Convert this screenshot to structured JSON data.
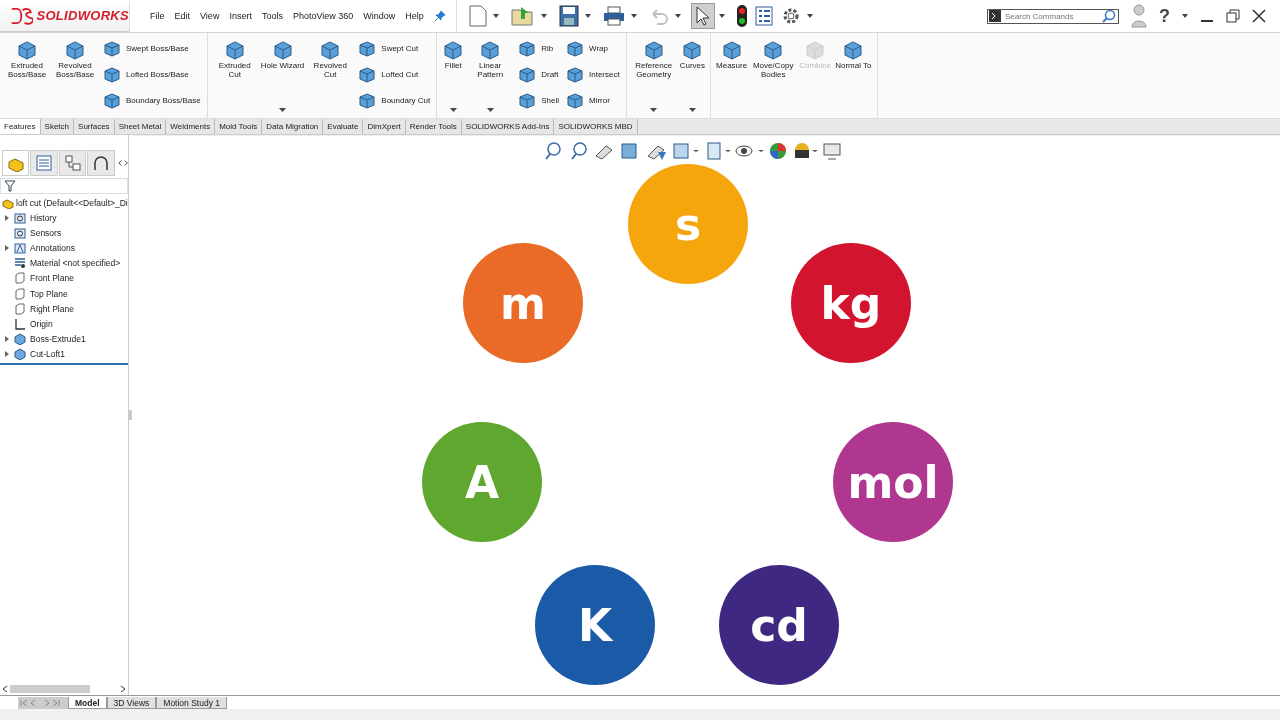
{
  "app": {
    "logo": "SOLIDWORKS"
  },
  "menu": [
    "File",
    "Edit",
    "View",
    "Insert",
    "Tools",
    "PhotoView 360",
    "Window",
    "Help"
  ],
  "toolbar": [
    {
      "kind": "new",
      "dropdown": true,
      "disabled": false,
      "selected": false
    },
    {
      "kind": "open",
      "dropdown": true,
      "disabled": false,
      "selected": false
    },
    {
      "kind": "save",
      "dropdown": true,
      "disabled": false,
      "selected": false
    },
    {
      "kind": "print",
      "dropdown": true,
      "disabled": false,
      "selected": false
    },
    {
      "kind": "undo",
      "dropdown": true,
      "disabled": true,
      "selected": false
    },
    {
      "kind": "select",
      "dropdown": true,
      "disabled": false,
      "selected": true
    },
    {
      "kind": "rebuild",
      "dropdown": false,
      "disabled": false,
      "selected": false
    },
    {
      "kind": "list",
      "dropdown": false,
      "disabled": false,
      "selected": false
    },
    {
      "kind": "gear",
      "dropdown": true,
      "disabled": false,
      "selected": false
    }
  ],
  "search": {
    "placeholder": "Search Commands"
  },
  "help": {
    "label": "?"
  },
  "ribbon": [
    {
      "buttons": [
        {
          "label": "Extruded Boss/Base",
          "kind": "large",
          "disabled": false,
          "dropdown": false
        },
        {
          "label": "Revolved Boss/Base",
          "kind": "large",
          "disabled": false,
          "dropdown": false
        },
        {
          "label": "Swept Boss/Base",
          "kind": "small",
          "disabled": false,
          "dropdown": false
        },
        {
          "label": "Lofted Boss/Base",
          "kind": "small",
          "disabled": false,
          "dropdown": false
        },
        {
          "label": "Boundary Boss/Base",
          "kind": "small",
          "disabled": false,
          "dropdown": false
        }
      ]
    },
    {
      "buttons": [
        {
          "label": "Extruded Cut",
          "kind": "large",
          "disabled": false,
          "dropdown": false
        },
        {
          "label": "Hole Wizard",
          "kind": "large",
          "disabled": false,
          "dropdown": true
        },
        {
          "label": "Revolved Cut",
          "kind": "large",
          "disabled": false,
          "dropdown": false
        },
        {
          "label": "Swept Cut",
          "kind": "small",
          "disabled": false,
          "dropdown": false
        },
        {
          "label": "Lofted Cut",
          "kind": "small",
          "disabled": false,
          "dropdown": false
        },
        {
          "label": "Boundary Cut",
          "kind": "small",
          "disabled": false,
          "dropdown": false
        }
      ]
    },
    {
      "buttons": [
        {
          "label": "Fillet",
          "kind": "large",
          "disabled": false,
          "dropdown": true
        },
        {
          "label": "Linear Pattern",
          "kind": "large",
          "disabled": false,
          "dropdown": true
        },
        {
          "label": "Rib",
          "kind": "small",
          "disabled": false,
          "dropdown": false
        },
        {
          "label": "Draft",
          "kind": "small",
          "disabled": false,
          "dropdown": false
        },
        {
          "label": "Shell",
          "kind": "small",
          "disabled": false,
          "dropdown": false
        },
        {
          "label": "Wrap",
          "kind": "small",
          "disabled": false,
          "dropdown": false
        },
        {
          "label": "Intersect",
          "kind": "small",
          "disabled": false,
          "dropdown": false
        },
        {
          "label": "Mirror",
          "kind": "small",
          "disabled": false,
          "dropdown": false
        }
      ]
    },
    {
      "buttons": [
        {
          "label": "Reference Geometry",
          "kind": "large",
          "disabled": false,
          "dropdown": true
        },
        {
          "label": "Curves",
          "kind": "large",
          "disabled": false,
          "dropdown": true
        }
      ]
    },
    {
      "buttons": [
        {
          "label": "Measure",
          "kind": "large",
          "disabled": false,
          "dropdown": false
        },
        {
          "label": "Move/Copy Bodies",
          "kind": "large",
          "disabled": false,
          "dropdown": false
        },
        {
          "label": "Combine",
          "kind": "large",
          "disabled": true,
          "dropdown": false
        },
        {
          "label": "Normal To",
          "kind": "large",
          "disabled": false,
          "dropdown": false
        }
      ]
    }
  ],
  "command_tabs": [
    {
      "label": "Features",
      "selected": true
    },
    {
      "label": "Sketch",
      "selected": false
    },
    {
      "label": "Surfaces",
      "selected": false
    },
    {
      "label": "Sheet Metal",
      "selected": false
    },
    {
      "label": "Weldments",
      "selected": false
    },
    {
      "label": "Mold Tools",
      "selected": false
    },
    {
      "label": "Data Migration",
      "selected": false
    },
    {
      "label": "Evaluate",
      "selected": false
    },
    {
      "label": "DimXpert",
      "selected": false
    },
    {
      "label": "Render Tools",
      "selected": false
    },
    {
      "label": "SOLIDWORKS Add-Ins",
      "selected": false
    },
    {
      "label": "SOLIDWORKS MBD",
      "selected": false
    }
  ],
  "panel_tabs": [
    {
      "kind": "part",
      "selected": true
    },
    {
      "kind": "property",
      "selected": false
    },
    {
      "kind": "config",
      "selected": false
    },
    {
      "kind": "dim",
      "selected": false
    }
  ],
  "tree": {
    "label": "loft cut  (Default<<Default>_Di",
    "children": [
      {
        "label": "History",
        "kind": "history",
        "expandable": true
      },
      {
        "label": "Sensors",
        "kind": "sensor",
        "expandable": false
      },
      {
        "label": "Annotations",
        "kind": "annotation",
        "expandable": true
      },
      {
        "label": "Material <not specified>",
        "kind": "material",
        "expandable": false
      },
      {
        "label": "Front Plane",
        "kind": "plane",
        "expandable": false
      },
      {
        "label": "Top Plane",
        "kind": "plane",
        "expandable": false
      },
      {
        "label": "Right Plane",
        "kind": "plane",
        "expandable": false
      },
      {
        "label": "Origin",
        "kind": "origin",
        "expandable": false
      },
      {
        "label": "Boss-Extrude1",
        "kind": "body",
        "expandable": true
      },
      {
        "label": "Cut-Loft1",
        "kind": "body",
        "expandable": true
      }
    ]
  },
  "units": [
    {
      "symbol": "s",
      "color": "#f5a60c"
    },
    {
      "symbol": "m",
      "color": "#ea6a28"
    },
    {
      "symbol": "kg",
      "color": "#d3142f"
    },
    {
      "symbol": "A",
      "color": "#5fa72e"
    },
    {
      "symbol": "mol",
      "color": "#af3790"
    },
    {
      "symbol": "K",
      "color": "#1b5aa7"
    },
    {
      "symbol": "cd",
      "color": "#3f2881"
    }
  ],
  "bottom_tabs": [
    {
      "label": "Model",
      "selected": true
    },
    {
      "label": "3D Views",
      "selected": false
    },
    {
      "label": "Motion Study 1",
      "selected": false
    }
  ]
}
